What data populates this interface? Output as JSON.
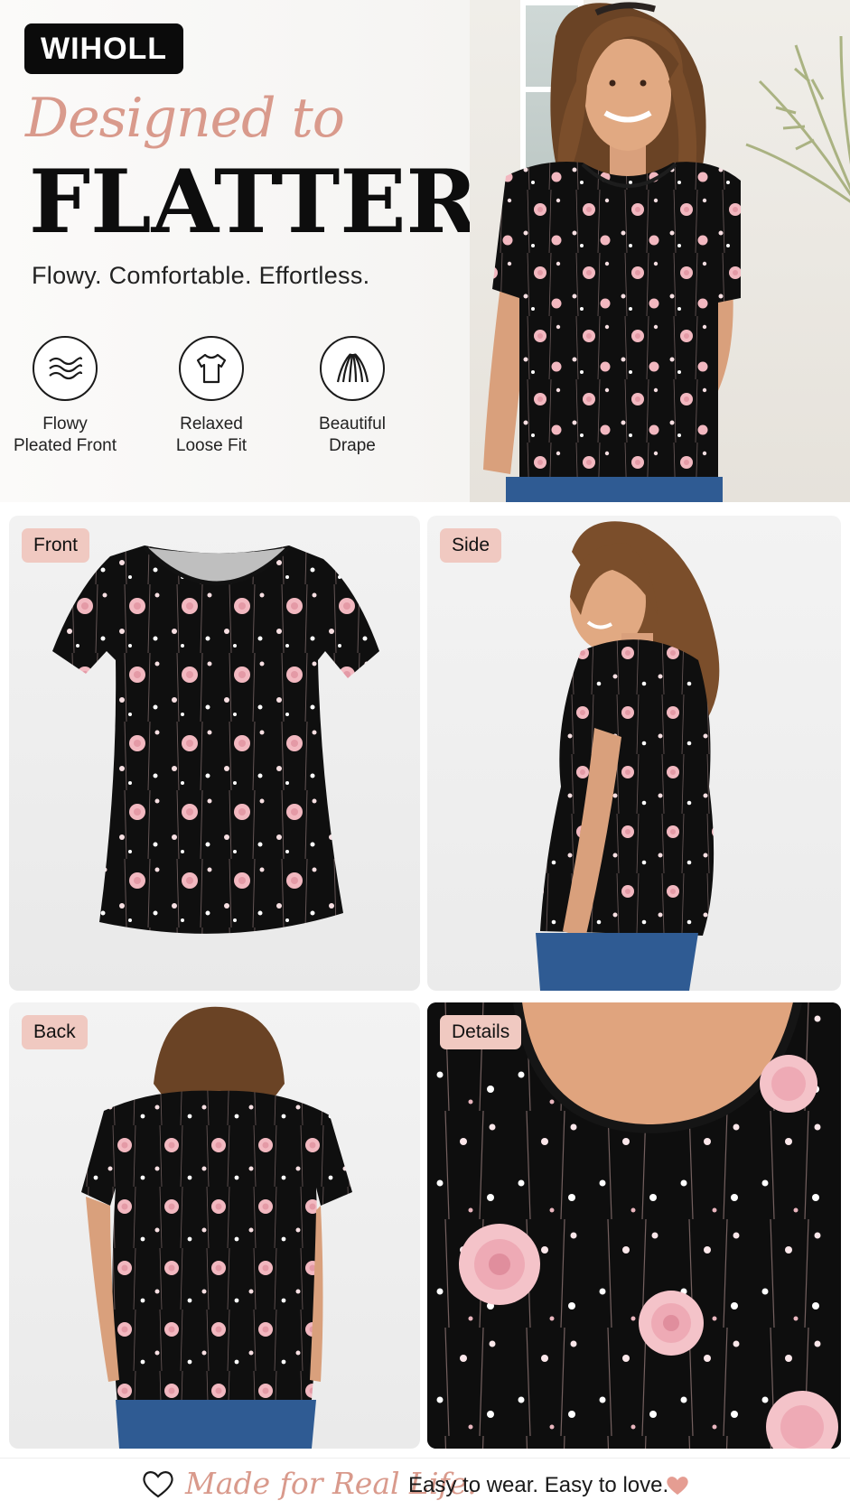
{
  "brand": {
    "name": "WIHOLL"
  },
  "hero": {
    "script_line": "Designed to",
    "headline": "FLATTER",
    "tagline": "Flowy. Comfortable. Effortless."
  },
  "features": [
    {
      "icon": "waves-icon",
      "line1": "Flowy",
      "line2": "Pleated Front"
    },
    {
      "icon": "tshirt-icon",
      "line1": "Relaxed",
      "line2": "Loose Fit"
    },
    {
      "icon": "drape-icon",
      "line1": "Beautiful",
      "line2": "Drape"
    }
  ],
  "views": {
    "front": "Front",
    "side": "Side",
    "back": "Back",
    "details": "Details"
  },
  "footer": {
    "script": "Made for Real Life.",
    "text": "Easy to wear. Easy to love.",
    "icons": [
      "heart-outline-icon",
      "heart-icon"
    ]
  },
  "colors": {
    "accent_pink": "#d99a8c",
    "tag_pink": "#f0c9c1",
    "blouse_black": "#0e0e0e",
    "flower_pink": "#f2b8c0"
  }
}
